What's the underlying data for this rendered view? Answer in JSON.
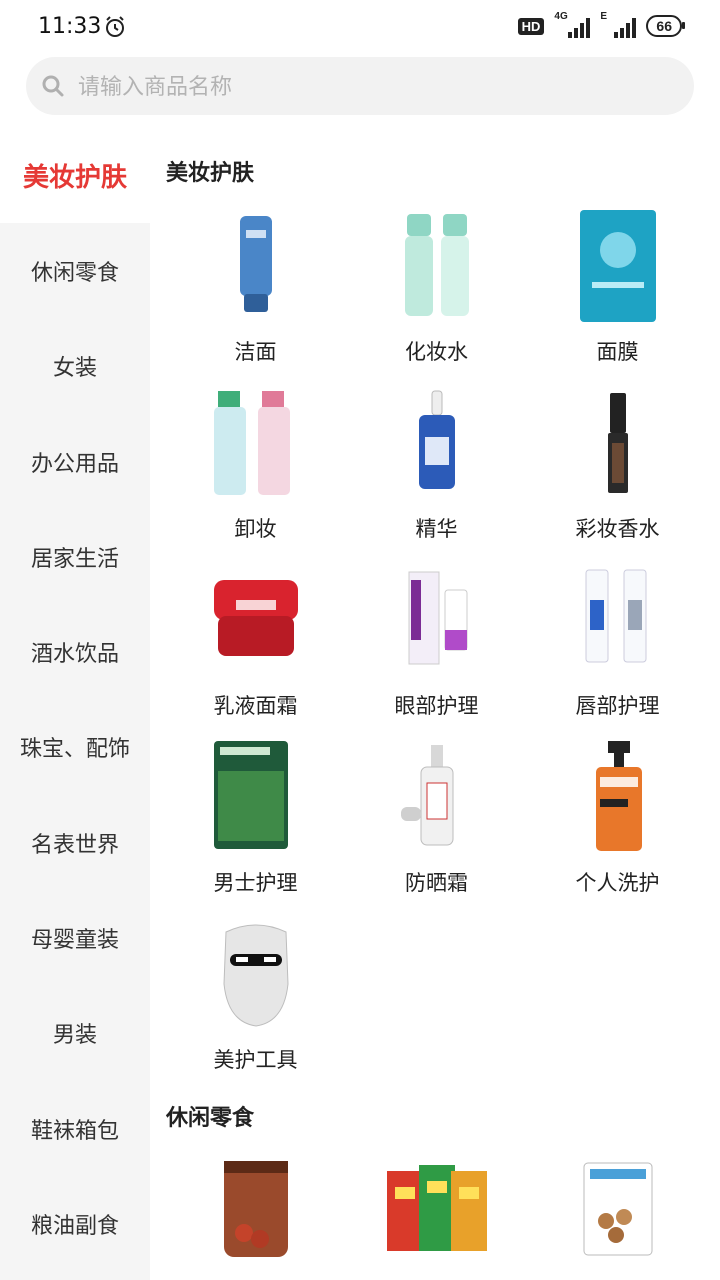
{
  "status": {
    "time": "11:33",
    "network_label": "HD",
    "net1": "4G",
    "net2": "E",
    "battery": "66"
  },
  "search": {
    "placeholder": "请输入商品名称"
  },
  "sidebar": {
    "items": [
      {
        "label": "美妆护肤",
        "active": true
      },
      {
        "label": "休闲零食"
      },
      {
        "label": "女装"
      },
      {
        "label": "办公用品"
      },
      {
        "label": "居家生活"
      },
      {
        "label": "酒水饮品"
      },
      {
        "label": "珠宝、配饰"
      },
      {
        "label": "名表世界"
      },
      {
        "label": "母婴童装"
      },
      {
        "label": "男装"
      },
      {
        "label": "鞋袜箱包"
      },
      {
        "label": "粮油副食"
      }
    ]
  },
  "sections": [
    {
      "title": "美妆护肤",
      "items": [
        {
          "label": "洁面"
        },
        {
          "label": "化妆水"
        },
        {
          "label": "面膜"
        },
        {
          "label": "卸妆"
        },
        {
          "label": "精华"
        },
        {
          "label": "彩妆香水"
        },
        {
          "label": "乳液面霜"
        },
        {
          "label": "眼部护理"
        },
        {
          "label": "唇部护理"
        },
        {
          "label": "男士护理"
        },
        {
          "label": "防晒霜"
        },
        {
          "label": "个人洗护"
        },
        {
          "label": "美护工具"
        }
      ]
    },
    {
      "title": "休闲零食",
      "items": []
    }
  ]
}
